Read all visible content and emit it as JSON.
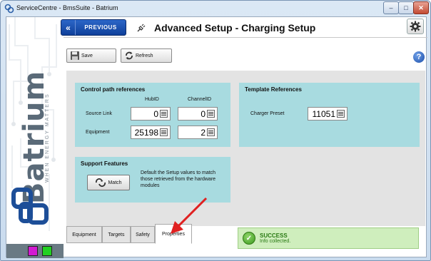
{
  "window": {
    "title": "ServiceCentre - BmsSuite - Batrium",
    "min_glyph": "–",
    "max_glyph": "□",
    "close_glyph": "✕"
  },
  "brand": {
    "name": "Batrium",
    "tagline": "WHEN ENERGY MATTERS"
  },
  "header": {
    "previous_label": "PREVIOUS",
    "previous_glyph": "«",
    "title": "Advanced Setup - Charging Setup"
  },
  "toolbar": {
    "save_label": "Save",
    "refresh_label": "Refresh",
    "help_glyph": "?"
  },
  "control_path": {
    "title": "Control path references",
    "col_hub": "HubID",
    "col_channel": "ChannelID",
    "rows": [
      {
        "label": "Source Link",
        "hub": "0",
        "channel": "0"
      },
      {
        "label": "Equipment",
        "hub": "25198",
        "channel": "2"
      }
    ]
  },
  "template_refs": {
    "title": "Template References",
    "label": "Charger Preset",
    "value": "11051"
  },
  "support": {
    "title": "Support Features",
    "match_label": "Match",
    "description": "Default the Setup values to match those retrieved from the hardware modules"
  },
  "tabs": [
    {
      "label": "Equipment",
      "active": false
    },
    {
      "label": "Targets",
      "active": false
    },
    {
      "label": "Safety",
      "active": false
    },
    {
      "label": "Properties",
      "active": true
    }
  ],
  "status": {
    "title": "SUCCESS",
    "message": "Info collected.",
    "icon": "check-icon"
  },
  "colors": {
    "group_bg": "#a8dbe0",
    "panel_bg": "#e3e3e3",
    "accent_blue": "#1a4fae",
    "success_bg": "#cfeebd",
    "arrow": "#e02020"
  }
}
